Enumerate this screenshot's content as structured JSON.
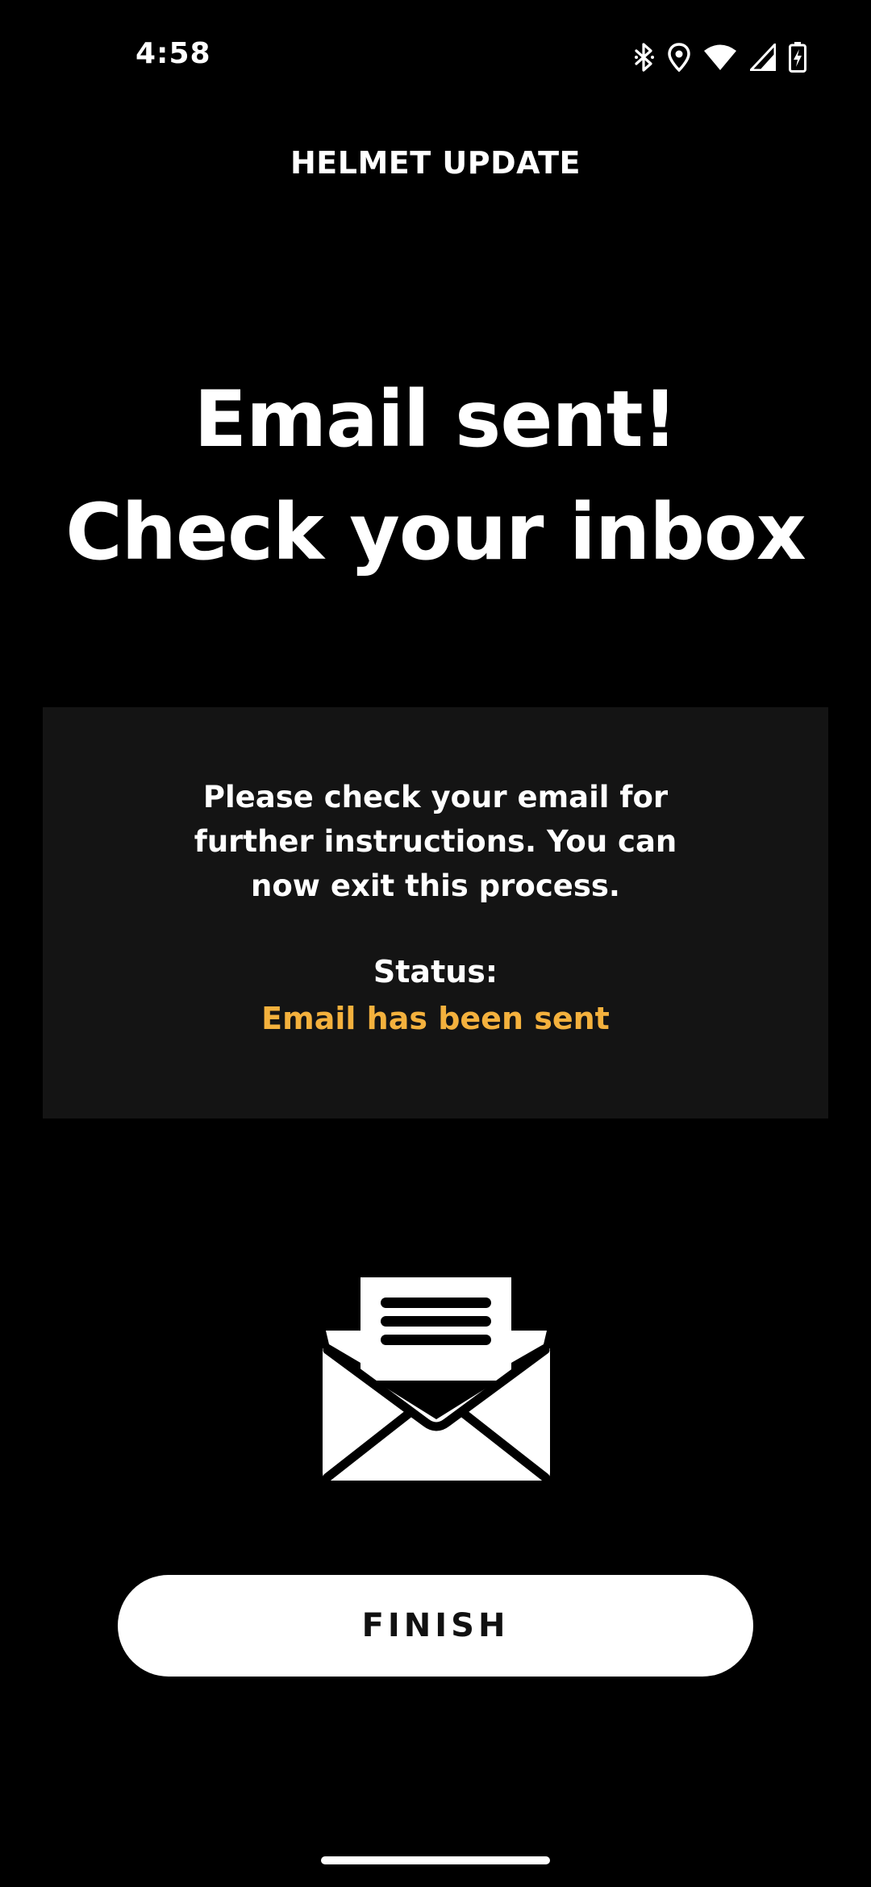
{
  "status_bar": {
    "time": "4:58",
    "icons": [
      "bluetooth-icon",
      "location-icon",
      "wifi-icon",
      "signal-icon",
      "battery-charging-icon"
    ]
  },
  "header": {
    "title": "HELMET UPDATE"
  },
  "headline": {
    "line1": "Email sent!",
    "line2": "Check your inbox"
  },
  "info_card": {
    "message": "Please check your email for further instructions. You can now exit this process.",
    "status_label": "Status:",
    "status_value": "Email has been sent"
  },
  "illustration": {
    "icon": "envelope-open-letter-icon"
  },
  "actions": {
    "finish_label": "FINISH"
  },
  "colors": {
    "background": "#000000",
    "card_background": "#141414",
    "status_accent": "#f4b13d",
    "button_background": "#ffffff"
  }
}
